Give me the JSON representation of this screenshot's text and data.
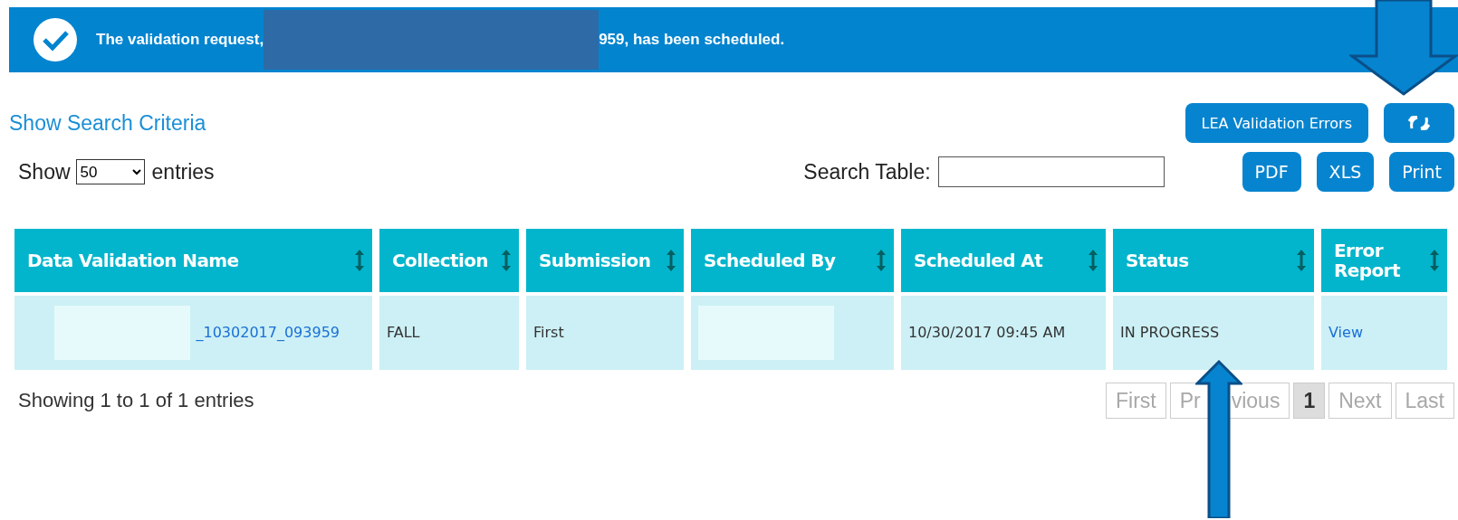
{
  "banner": {
    "text_before": "The validation request,",
    "text_after": "959, has been scheduled."
  },
  "search_criteria_link": "Show Search Criteria",
  "toolbar": {
    "buttons": [
      {
        "kind": "text",
        "label": "LEA Validation Errors"
      },
      {
        "kind": "refresh"
      }
    ]
  },
  "export_buttons": [
    "PDF",
    "XLS",
    "Print"
  ],
  "entries": {
    "before": "Show",
    "value": "50",
    "after": "entries"
  },
  "search": {
    "label": "Search Table:"
  },
  "table": {
    "columns": [
      "Data Validation Name",
      "Collection",
      "Submission",
      "Scheduled By",
      "Scheduled At",
      "Status",
      "Error Report"
    ],
    "rows": [
      [
        {
          "kind": "link",
          "text": "_10302017_093959",
          "redacted": true
        },
        {
          "kind": "text",
          "text": "FALL"
        },
        {
          "kind": "text",
          "text": "First"
        },
        {
          "kind": "redacted"
        },
        {
          "kind": "text",
          "text": "10/30/2017 09:45 AM"
        },
        {
          "kind": "text",
          "text": "IN PROGRESS"
        },
        {
          "kind": "link",
          "text": "View"
        }
      ]
    ]
  },
  "info": "Showing 1 to 1 of 1 entries",
  "pagination": [
    {
      "label": "First",
      "disabled": true,
      "selected": false
    },
    {
      "label": "Pr",
      "label_end": "vious",
      "disabled": true,
      "selected": false
    },
    {
      "label": "1",
      "disabled": false,
      "selected": true
    },
    {
      "label": "Next",
      "disabled": true,
      "selected": false
    },
    {
      "label": "Last",
      "disabled": true,
      "selected": false
    }
  ]
}
